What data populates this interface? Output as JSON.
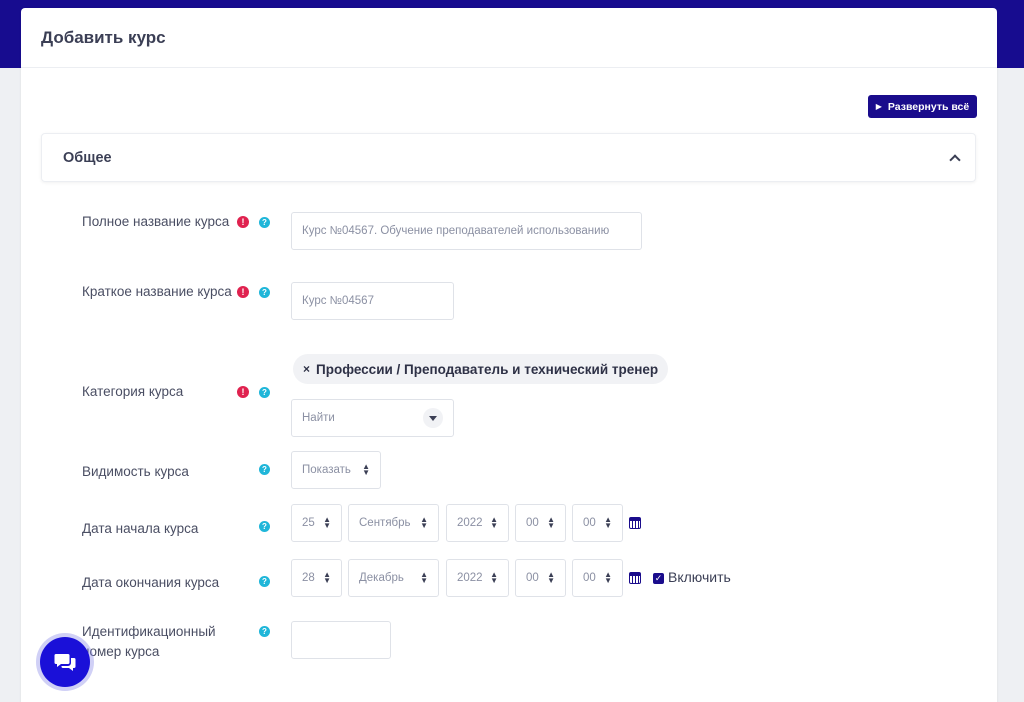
{
  "header": {
    "title": "Добавить курс"
  },
  "toolbar": {
    "expand_all_label": "Развернуть всё"
  },
  "section": {
    "title": "Общее"
  },
  "fields": {
    "fullname": {
      "label": "Полное название курса",
      "value": "Курс №04567. Обучение преподавателей использованию"
    },
    "shortname": {
      "label": "Краткое название курса",
      "value": "Курс №04567"
    },
    "category": {
      "label": "Категория курса",
      "tag": "Профессии / Преподаватель и технический тренер",
      "tag_remove": "×",
      "search_placeholder": "Найти"
    },
    "visibility": {
      "label": "Видимость курса",
      "value": "Показать"
    },
    "startdate": {
      "label": "Дата начала курса",
      "day": "25",
      "month": "Сентябрь",
      "year": "2022",
      "hour": "00",
      "minute": "00"
    },
    "enddate": {
      "label": "Дата окончания курса",
      "day": "28",
      "month": "Декабрь",
      "year": "2022",
      "hour": "00",
      "minute": "00",
      "enable_label": "Включить",
      "enabled": true
    },
    "idnumber": {
      "label": "Идентификационный номер курса",
      "value": ""
    }
  },
  "icons": {
    "required": "exclamation-icon",
    "help": "question-icon",
    "calendar": "calendar-icon",
    "chat": "chat-icon"
  },
  "colors": {
    "brand": "#170c8f",
    "required": "#e0224f",
    "help": "#1fb6d9",
    "chat": "#1a10d8"
  }
}
